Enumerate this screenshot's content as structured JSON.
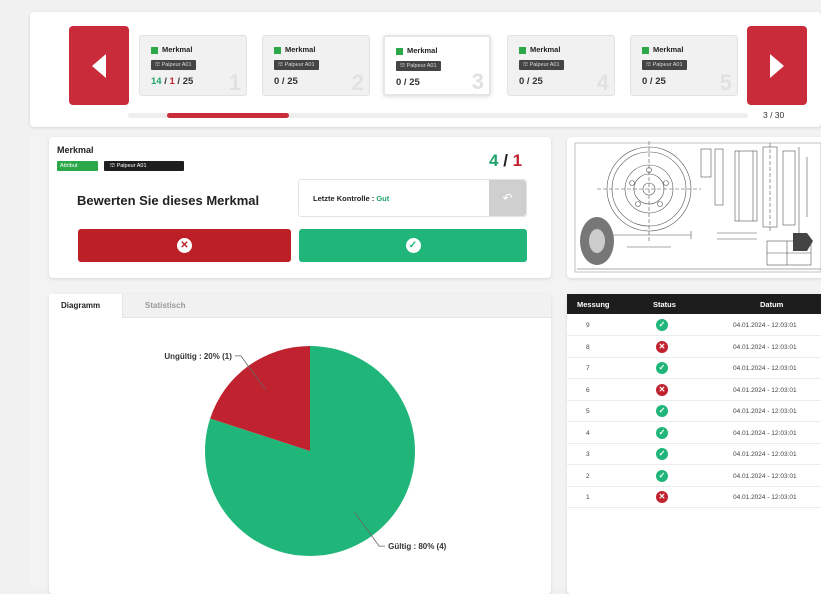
{
  "carousel": {
    "items": [
      {
        "name": "Merkmal",
        "tag": "⛫ Palpeur A01",
        "done": "14",
        "fail": "1",
        "total": "25",
        "index": "1"
      },
      {
        "name": "Merkmal",
        "tag": "⛫ Palpeur A01",
        "count": "0 / 25",
        "index": "2"
      },
      {
        "name": "Merkmal",
        "tag": "⛫ Palpeur A01",
        "count": "0 / 25",
        "index": "3"
      },
      {
        "name": "Merkmal",
        "tag": "⛫ Palpeur A01",
        "count": "0 / 25",
        "index": "4"
      },
      {
        "name": "Merkmal",
        "tag": "⛫ Palpeur A01",
        "count": "0 / 25",
        "index": "5"
      }
    ],
    "active_index": 3,
    "pager": "3 / 30",
    "scroll_fraction": 0.2
  },
  "evaluation": {
    "title": "Merkmal",
    "attribute_tag": "Attribut",
    "probe_tag": "⛫ Palpeur A01",
    "score_good": "4",
    "score_sep": " / ",
    "score_bad": "1",
    "prompt": "Bewerten Sie dieses Merkmal",
    "last_control_label": "Letzte Kontrolle : ",
    "last_control_value": "Gut",
    "undo_icon": "↶",
    "reject_icon": "✕",
    "accept_icon": "✓"
  },
  "tabs": [
    {
      "label": "Diagramm"
    },
    {
      "label": "Statistisch"
    }
  ],
  "chart_data": {
    "type": "pie",
    "slices": [
      {
        "label": "Gültig",
        "percent": 80,
        "count": 4,
        "color": "#21b679",
        "text": "Gültig : 80% (4)"
      },
      {
        "label": "Ungültig",
        "percent": 20,
        "count": 1,
        "color": "#c0232f",
        "text": "Ungültig : 20% (1)"
      }
    ]
  },
  "table": {
    "headers": [
      "Messung",
      "Status",
      "Datum"
    ],
    "rows": [
      {
        "n": "9",
        "status": "ok",
        "date": "04.01.2024 - 12:03:01"
      },
      {
        "n": "8",
        "status": "ko",
        "date": "04.01.2024 - 12:03:01"
      },
      {
        "n": "7",
        "status": "ok",
        "date": "04.01.2024 - 12:03:01"
      },
      {
        "n": "6",
        "status": "ko",
        "date": "04.01.2024 - 12:03:01"
      },
      {
        "n": "5",
        "status": "ok",
        "date": "04.01.2024 - 12:03:01"
      },
      {
        "n": "4",
        "status": "ok",
        "date": "04.01.2024 - 12:03:01"
      },
      {
        "n": "3",
        "status": "ok",
        "date": "04.01.2024 - 12:03:01"
      },
      {
        "n": "2",
        "status": "ok",
        "date": "04.01.2024 - 12:03:01"
      },
      {
        "n": "1",
        "status": "ko",
        "date": "04.01.2024 - 12:03:01"
      }
    ]
  },
  "colors": {
    "accent_red": "#c92b3a",
    "ok_green": "#21b679",
    "ko_red": "#c0232f"
  }
}
